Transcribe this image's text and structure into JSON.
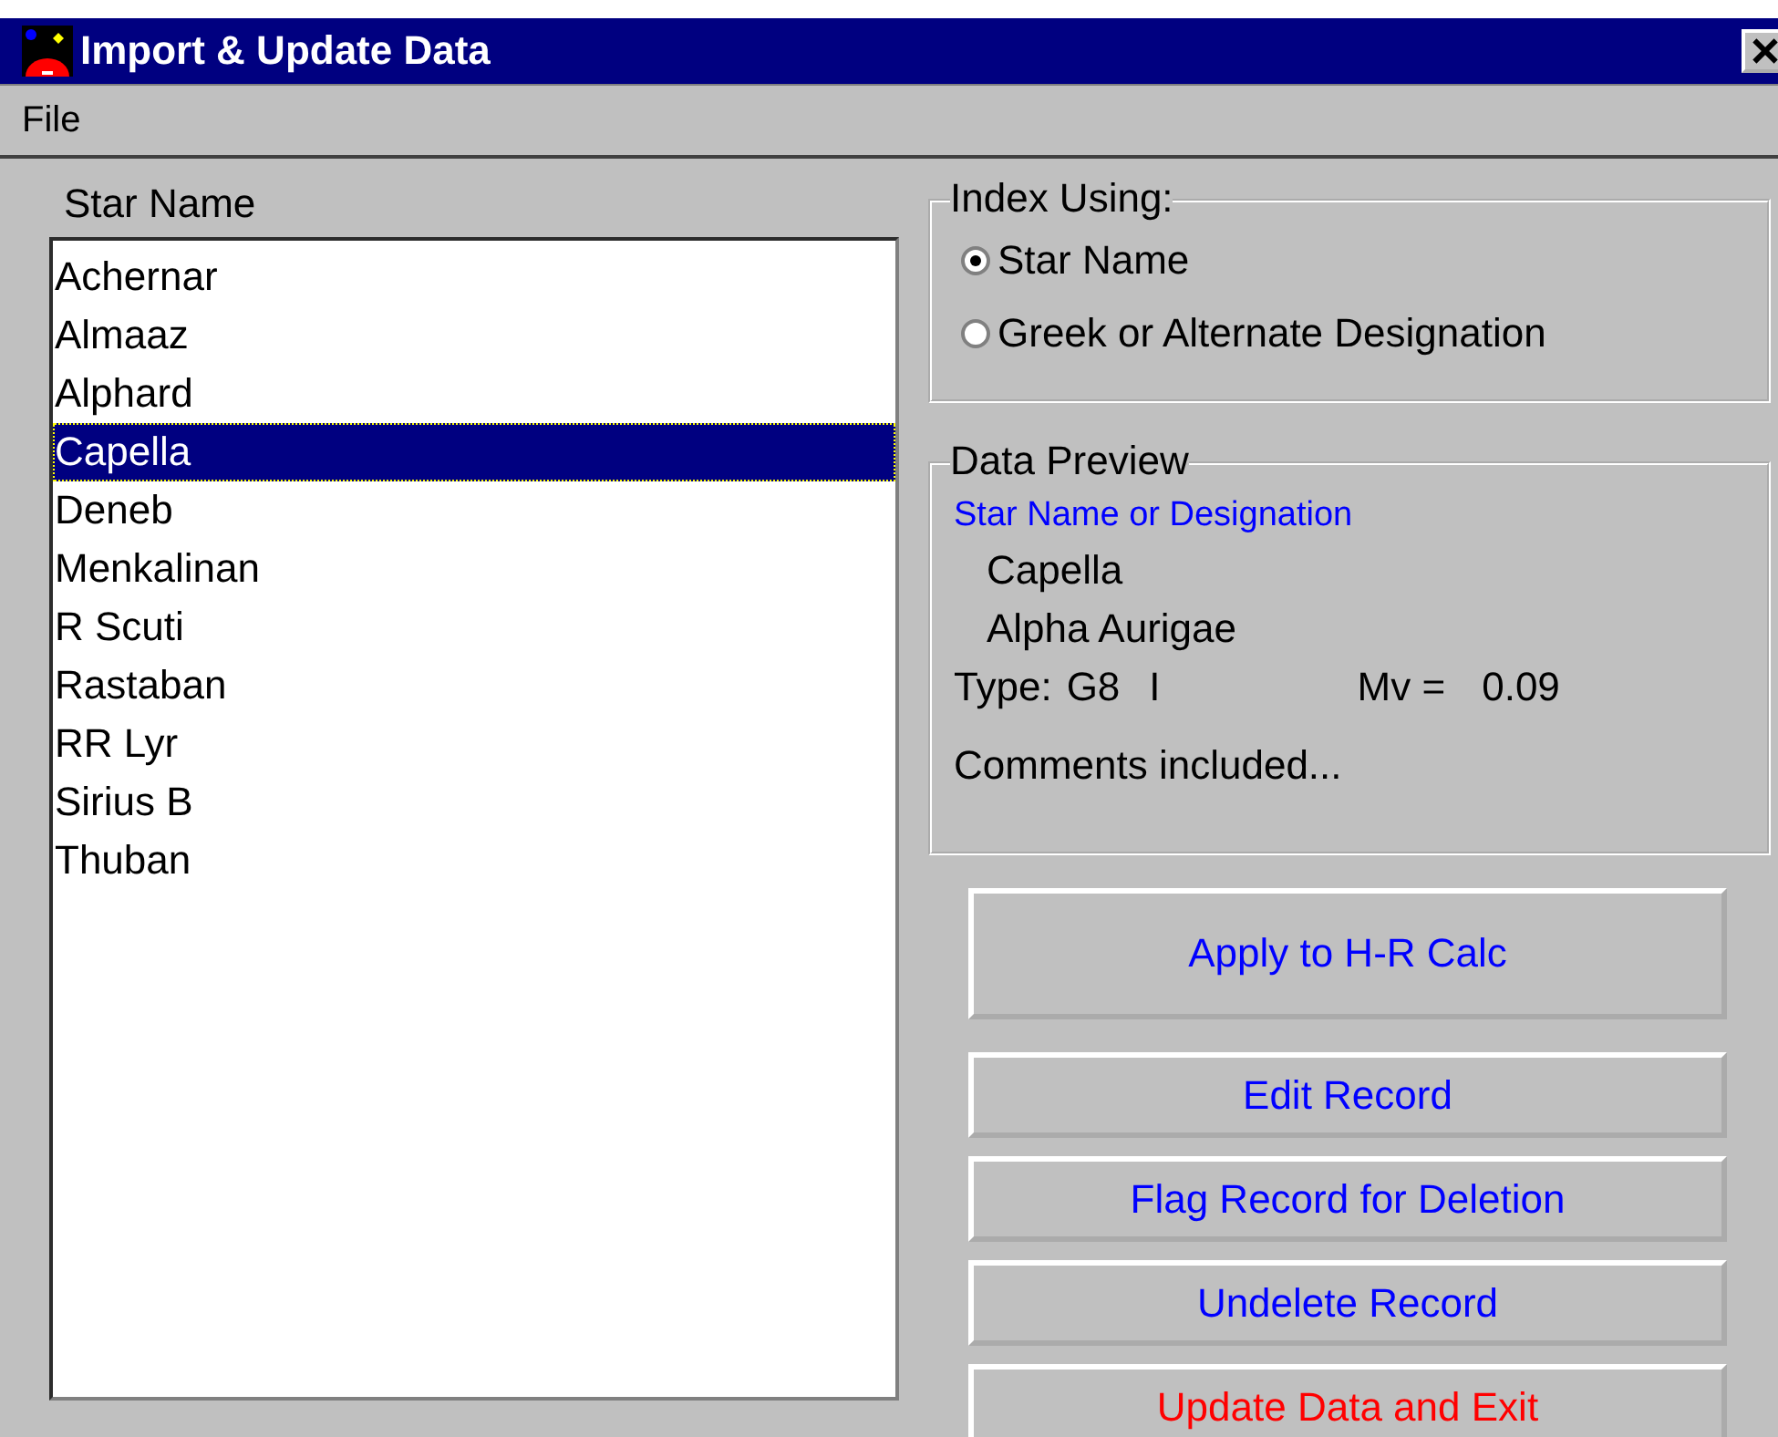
{
  "window": {
    "title": "Import & Update Data"
  },
  "menu": [
    "File"
  ],
  "star_list": {
    "label": "Star Name",
    "items": [
      {
        "name": "Achernar",
        "selected": false
      },
      {
        "name": "Almaaz",
        "selected": false
      },
      {
        "name": "Alphard",
        "selected": false
      },
      {
        "name": "Capella",
        "selected": true
      },
      {
        "name": "Deneb",
        "selected": false
      },
      {
        "name": "Menkalinan",
        "selected": false
      },
      {
        "name": "R Scuti",
        "selected": false
      },
      {
        "name": "Rastaban",
        "selected": false
      },
      {
        "name": "RR Lyr",
        "selected": false
      },
      {
        "name": "Sirius B",
        "selected": false
      },
      {
        "name": "Thuban",
        "selected": false
      }
    ]
  },
  "index_using": {
    "label": "Index Using:",
    "options": [
      {
        "label": "Star Name",
        "selected": true
      },
      {
        "label": "Greek or Alternate Designation",
        "selected": false
      }
    ]
  },
  "data_preview": {
    "label": "Data Preview",
    "heading": "Star Name or Designation",
    "name": "Capella",
    "designation": "Alpha Aurigae",
    "type_label": "Type:",
    "type_value": "G8",
    "luminosity_class": "I",
    "mv_label": "Mv =",
    "mv_value": "0.09",
    "comments": "Comments included..."
  },
  "buttons": [
    {
      "label": "Apply to H-R Calc",
      "kind": "large"
    },
    {
      "label": "Edit Record",
      "kind": "normal"
    },
    {
      "label": "Flag Record for Deletion",
      "kind": "normal"
    },
    {
      "label": "Undelete Record",
      "kind": "normal"
    },
    {
      "label": "Update Data and Exit",
      "kind": "exit"
    }
  ]
}
